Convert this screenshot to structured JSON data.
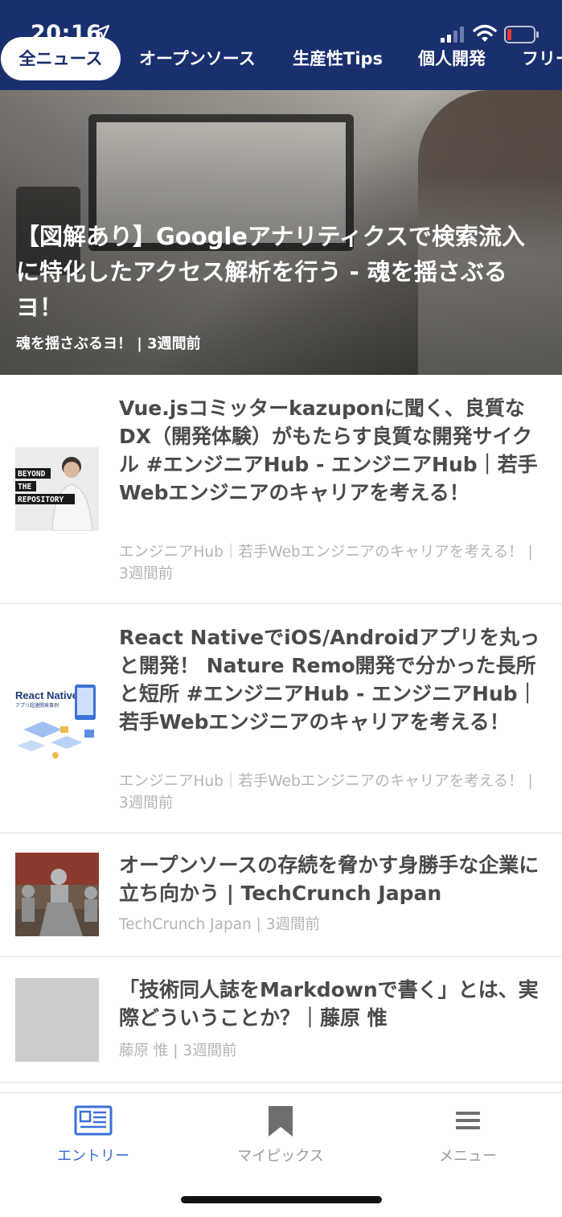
{
  "status_bar": {
    "time": "20:16"
  },
  "tabs": [
    {
      "label": "全ニュース",
      "active": true
    },
    {
      "label": "オープンソース",
      "active": false
    },
    {
      "label": "生産性Tips",
      "active": false
    },
    {
      "label": "個人開発",
      "active": false
    },
    {
      "label": "フリー",
      "active": false
    }
  ],
  "hero": {
    "title": "【図解あり】Googleアナリティクスで検索流入に特化したアクセス解析を行う - 魂を揺さぶるヨ！",
    "meta": "魂を揺さぶるヨ！ | 3週間前"
  },
  "articles": [
    {
      "title": "Vue.jsコミッターkazuponに聞く、良質なDX（開発体験）がもたらす良質な開発サイクル #エンジニアHub - エンジニアHub｜若手Webエンジニアのキャリアを考える！",
      "meta": "エンジニアHub｜若手Webエンジニアのキャリアを考える！ | 3週間前",
      "thumb_text": [
        "BEYOND",
        "THE",
        "REPOSITORY"
      ]
    },
    {
      "title": "React NativeでiOS/Androidアプリを丸っと開発！ Nature Remo開発で分かった長所と短所 #エンジニアHub - エンジニアHub｜若手Webエンジニアのキャリアを考える！",
      "meta": "エンジニアHub｜若手Webエンジニアのキャリアを考える！ | 3週間前",
      "thumb_text": [
        "React Native",
        "アプリ超速開発事例"
      ]
    },
    {
      "title": "オープンソースの存続を脅かす身勝手な企業に立ち向かう | TechCrunch Japan",
      "meta": "TechCrunch Japan | 3週間前"
    },
    {
      "title": "「技術同人誌をMarkdownで書く」とは、実際どういうことか？｜藤原 惟",
      "meta": "藤原 惟 | 3週間前"
    }
  ],
  "tabbar": {
    "items": [
      {
        "label": "エントリー",
        "icon": "newspaper-icon",
        "active": true
      },
      {
        "label": "マイピックス",
        "icon": "bookmark-icon",
        "active": false
      },
      {
        "label": "メニュー",
        "icon": "menu-icon",
        "active": false
      }
    ]
  },
  "colors": {
    "header_bg": "#1a2f6e",
    "active_tab_text": "#1a2f6e",
    "tabbar_active": "#3a6fd8",
    "tabbar_inactive": "#9a9a9a",
    "meta_text": "#b4b4b4",
    "battery_low": "#e53935"
  }
}
